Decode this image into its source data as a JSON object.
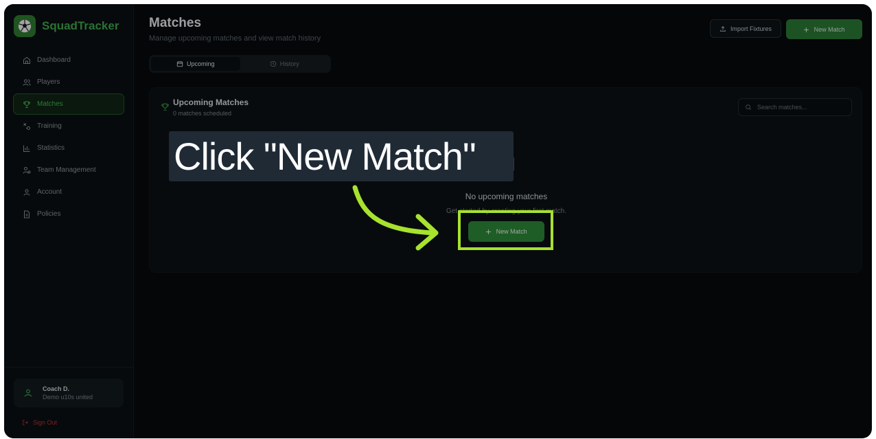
{
  "app": {
    "name": "SquadTracker"
  },
  "sidebar": {
    "items": [
      {
        "label": "Dashboard",
        "icon": "home-icon"
      },
      {
        "label": "Players",
        "icon": "users-icon"
      },
      {
        "label": "Matches",
        "icon": "trophy-icon",
        "active": true
      },
      {
        "label": "Training",
        "icon": "training-icon"
      },
      {
        "label": "Statistics",
        "icon": "bar-chart-icon"
      },
      {
        "label": "Team Management",
        "icon": "team-icon"
      },
      {
        "label": "Account",
        "icon": "user-icon"
      },
      {
        "label": "Policies",
        "icon": "document-icon"
      }
    ],
    "user": {
      "name": "Coach D.",
      "team": "Demo u10s united"
    },
    "sign_out": "Sign Out"
  },
  "header": {
    "title": "Matches",
    "subtitle": "Manage upcoming matches and view match history",
    "import_label": "Import Fixtures",
    "new_match_label": "New Match"
  },
  "tabs": [
    {
      "label": "Upcoming",
      "active": true
    },
    {
      "label": "History",
      "active": false
    }
  ],
  "card": {
    "title": "Upcoming Matches",
    "subtitle": "0 matches scheduled",
    "search_placeholder": "Search matches...",
    "empty_title": "No upcoming matches",
    "empty_subtitle": "Get started by creating your first match.",
    "new_match_label": "New Match"
  },
  "overlay": {
    "instruction": "Click \"New Match\"",
    "highlight_color": "#a6e22e"
  },
  "colors": {
    "accent_green": "#2b7a35",
    "active_nav_text": "#43b553",
    "sign_out": "#b33434"
  }
}
